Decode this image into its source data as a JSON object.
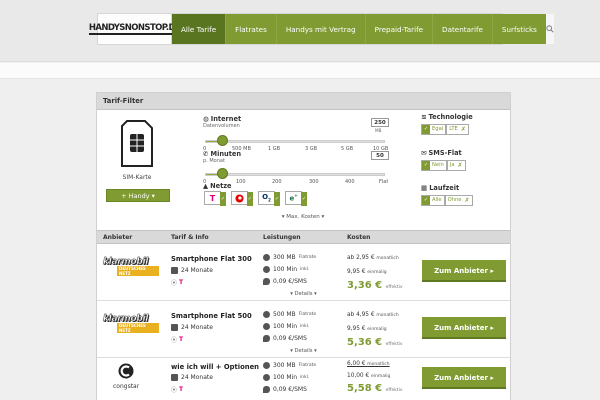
{
  "header": {
    "logo": "HANDYSNONSTOP.DE",
    "nav": [
      "Alle Tarife",
      "Flatrates",
      "Handys mit Vertrag",
      "Prepaid-Tarife",
      "Datentarife",
      "Surfsticks"
    ],
    "active_index": 0,
    "search_icon": "search-icon"
  },
  "filter": {
    "title": "Tarif-Filter",
    "sim_label": "SIM-Karte",
    "handy_button": "+ Handy ▾",
    "internet": {
      "title": "Internet",
      "sub": "Datenvolumen",
      "value": "250",
      "unit": "MB",
      "ticks": [
        "0",
        "500 MB",
        "1 GB",
        "3 GB",
        "5 GB",
        "10 GB"
      ]
    },
    "minuten": {
      "title": "Minuten",
      "sub": "p. Monat",
      "value": "50",
      "ticks": [
        "0",
        "100",
        "200",
        "300",
        "400",
        "Flat"
      ]
    },
    "netze": {
      "title": "Netze",
      "items": [
        "T",
        "Vodafone",
        "O2",
        "E-Plus"
      ]
    },
    "technologie": {
      "title": "Technologie",
      "options": [
        "Egal",
        "LTE"
      ]
    },
    "sms_flat": {
      "title": "SMS-Flat",
      "options": [
        "Nein",
        "Ja"
      ]
    },
    "laufzeit": {
      "title": "Laufzeit",
      "options": [
        "Alle",
        "Ohne"
      ]
    },
    "max_kosten": "▾ Max. Kosten ▾"
  },
  "table": {
    "headers": [
      "Anbieter",
      "Tarif & Info",
      "Leistungen",
      "Kosten"
    ],
    "rows": [
      {
        "provider": "klarmobil",
        "provider_sub": "DEUTSCHES NETZ",
        "name": "Smartphone Flat 300",
        "term": "24 Monate",
        "data": "300 MB",
        "data_sub": "Flatrate",
        "minutes": "100 Min",
        "minutes_sub": "inkl.",
        "sms": "0,09 €/SMS",
        "monthly_prefix": "ab",
        "monthly": "2,95 €",
        "monthly_sub": "monatlich",
        "once": "9,95 €",
        "once_sub": "einmalig",
        "effective": "3,36 €",
        "effective_sub": "effektiv",
        "cta": "Zum Anbieter ▸",
        "details": "▾ Details ▾"
      },
      {
        "provider": "klarmobil",
        "provider_sub": "DEUTSCHES NETZ",
        "name": "Smartphone Flat 500",
        "term": "24 Monate",
        "data": "500 MB",
        "data_sub": "Flatrate",
        "minutes": "100 Min",
        "minutes_sub": "inkl.",
        "sms": "0,09 €/SMS",
        "monthly_prefix": "ab",
        "monthly": "4,95 €",
        "monthly_sub": "monatlich",
        "once": "9,95 €",
        "once_sub": "einmalig",
        "effective": "5,36 €",
        "effective_sub": "effektiv",
        "cta": "Zum Anbieter ▸",
        "details": "▾ Details ▾"
      },
      {
        "provider": "congstar",
        "provider_sub": "",
        "name": "wie ich will + Optionen",
        "term": "24 Monate",
        "data": "300 MB",
        "data_sub": "Flatrate",
        "minutes": "100 Min",
        "minutes_sub": "inkl.",
        "sms": "0,09 €/SMS",
        "monthly_prefix": "",
        "monthly": "6,00 €",
        "monthly_sub": "monatlich",
        "once": "10,00 €",
        "once_sub": "einmalig",
        "effective": "5,58 €",
        "effective_sub": "effektiv",
        "cta": "Zum Anbieter ▸",
        "details": ""
      }
    ]
  },
  "colors": {
    "accent": "#7f9b32",
    "accent_dark": "#5a7520",
    "telekom": "#e20074"
  }
}
